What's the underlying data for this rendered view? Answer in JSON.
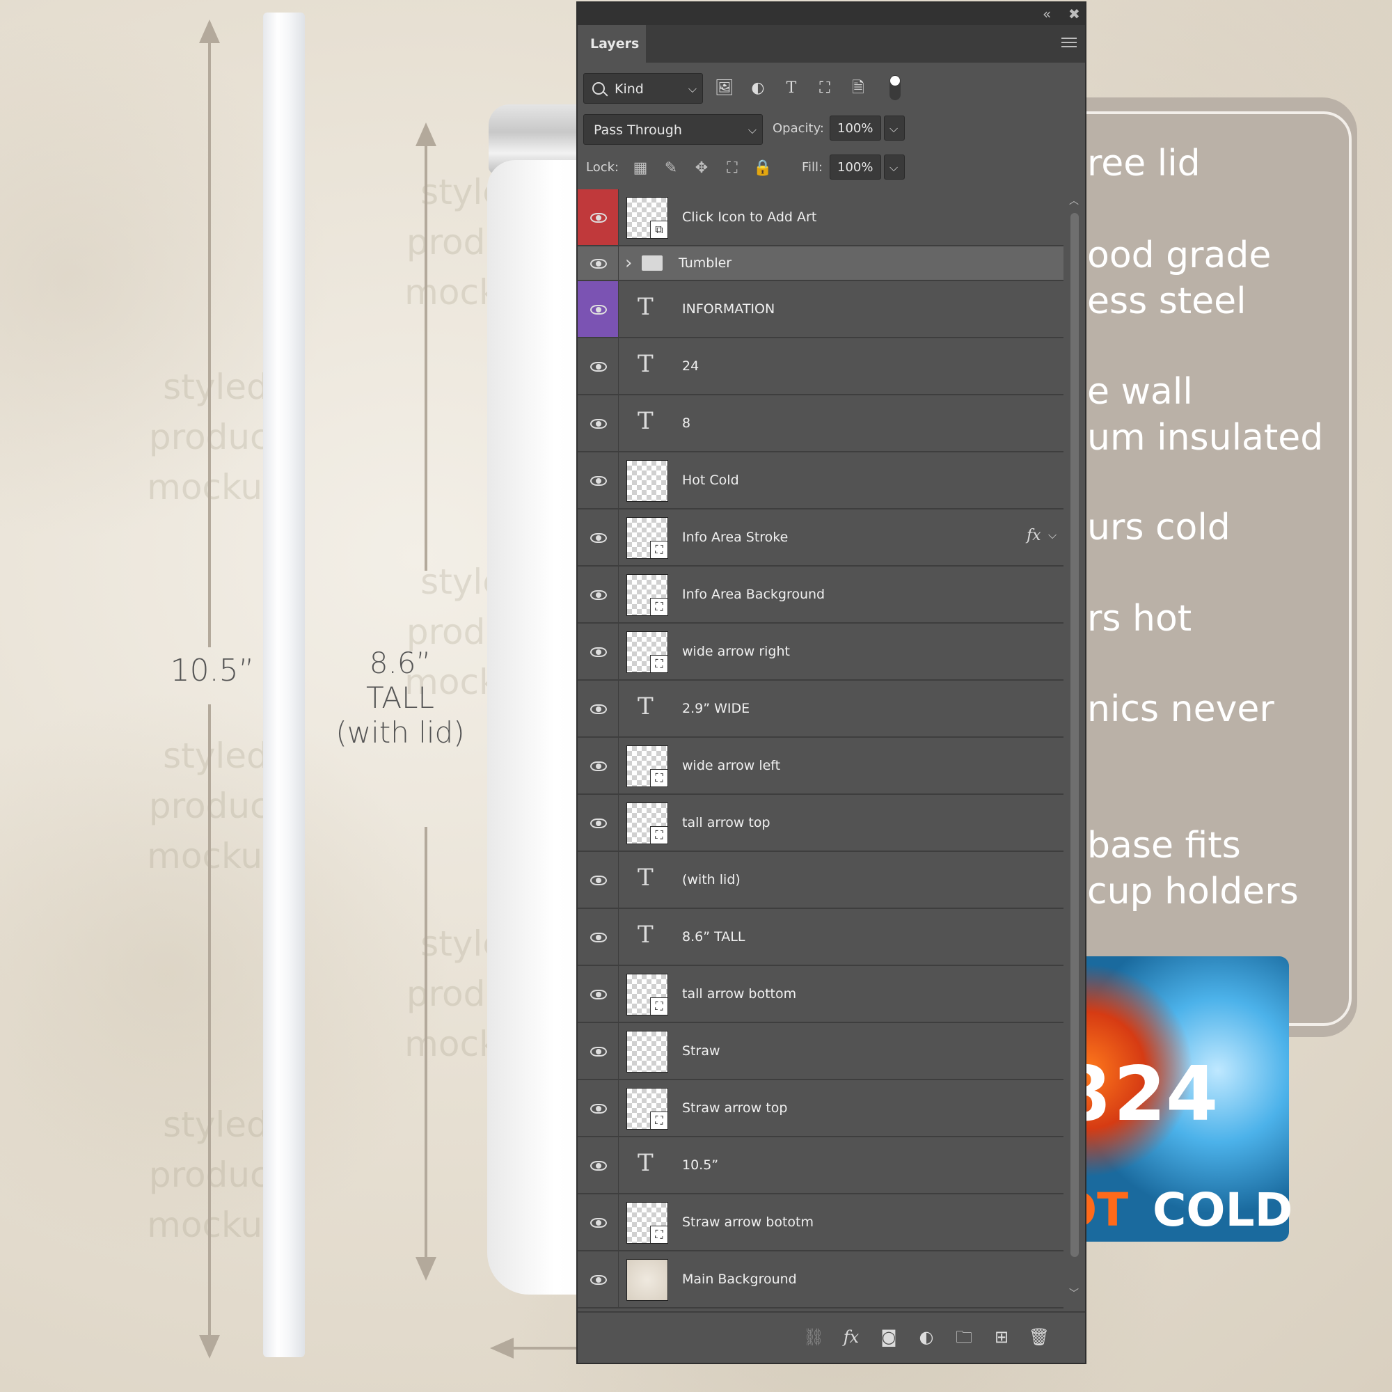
{
  "canvas": {
    "watermark_text": "styled\nproduct\nmockup",
    "straw_dimension": "10.5”",
    "tumbler_dimension": [
      "8.6”",
      "TALL",
      "(with lid)"
    ],
    "info_lines": [
      "ree lid",
      "ood grade",
      "ess steel",
      "e wall",
      "um insulated",
      "urs cold",
      "rs hot",
      "nics never",
      "base fits",
      "cup holders"
    ],
    "hotcold": {
      "left_number": "8",
      "right_number": "24",
      "hot_label": "OT",
      "cold_label": "COLD"
    }
  },
  "panel": {
    "collapse_glyph": "«",
    "close_glyph": "✖",
    "tab_label": "Layers",
    "filter": {
      "kind_label": "Kind",
      "icons": [
        "image-filter-icon",
        "adjustment-filter-icon",
        "type-filter-icon",
        "shape-filter-icon",
        "smart-object-filter-icon",
        "filter-toggle-icon"
      ]
    },
    "blend_mode": "Pass Through",
    "opacity_label": "Opacity:",
    "opacity_value": "100%",
    "lock_label": "Lock:",
    "fill_label": "Fill:",
    "fill_value": "100%",
    "layers": [
      {
        "name": "Click Icon to Add Art",
        "kind": "smart",
        "eye_color": "#c0393b"
      },
      {
        "name": "Tumbler",
        "kind": "group",
        "selected": true
      },
      {
        "name": "INFORMATION",
        "kind": "text",
        "eye_color": "#7b53b3"
      },
      {
        "name": "24",
        "kind": "text"
      },
      {
        "name": "8",
        "kind": "text"
      },
      {
        "name": "Hot Cold",
        "kind": "pixel"
      },
      {
        "name": "Info Area Stroke",
        "kind": "shape",
        "fx": "fx"
      },
      {
        "name": "Info Area Background",
        "kind": "shape"
      },
      {
        "name": "wide arrow right",
        "kind": "shape"
      },
      {
        "name": "2.9” WIDE",
        "kind": "text"
      },
      {
        "name": "wide arrow left",
        "kind": "shape"
      },
      {
        "name": "tall arrow top",
        "kind": "shape"
      },
      {
        "name": "(with lid)",
        "kind": "text"
      },
      {
        "name": "8.6” TALL",
        "kind": "text"
      },
      {
        "name": "tall arrow bottom",
        "kind": "shape"
      },
      {
        "name": "Straw",
        "kind": "pixel"
      },
      {
        "name": "Straw arrow top",
        "kind": "shape"
      },
      {
        "name": "10.5”",
        "kind": "text"
      },
      {
        "name": "Straw arrow bototm",
        "kind": "shape"
      },
      {
        "name": "Main Background",
        "kind": "background"
      }
    ],
    "bottom_icons": [
      "link-layers-icon",
      "layer-style-icon",
      "add-mask-icon",
      "adjustment-layer-icon",
      "new-group-icon",
      "new-layer-icon",
      "delete-layer-icon"
    ]
  }
}
